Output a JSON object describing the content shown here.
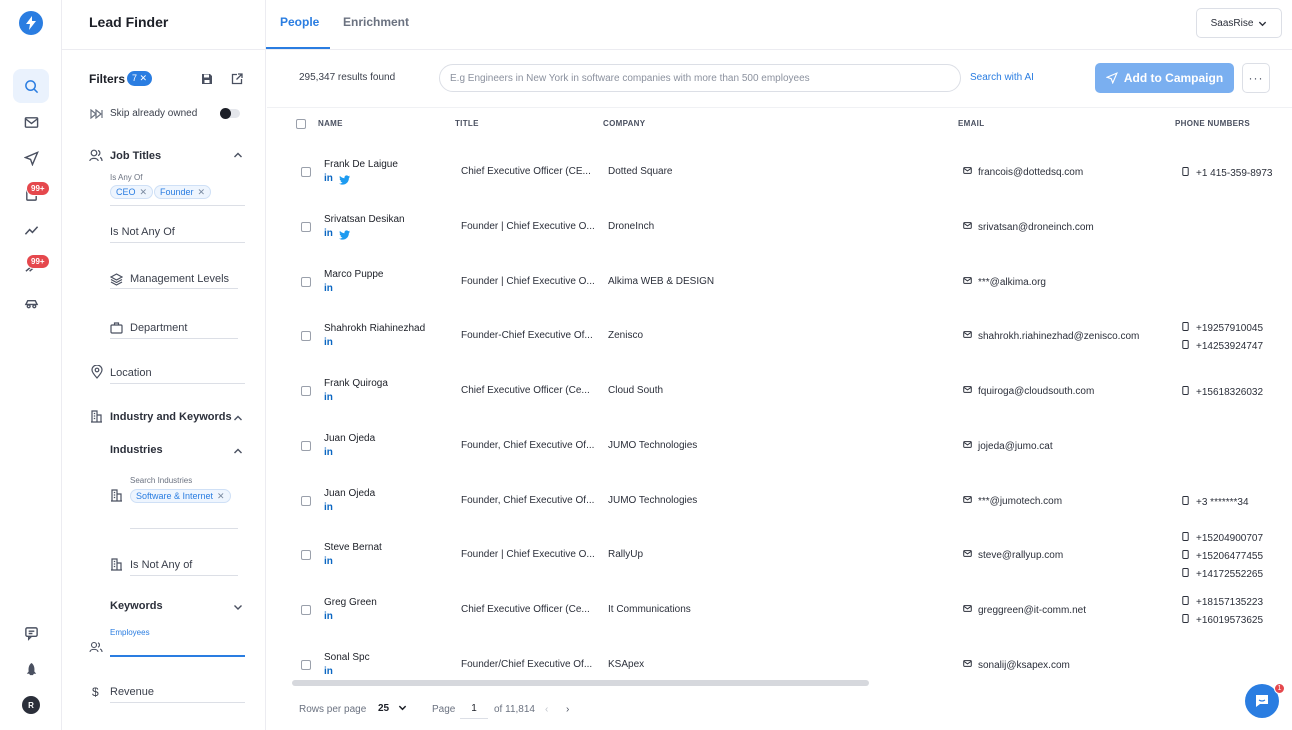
{
  "app": {
    "title": "Lead Finder",
    "workspace": "SaasRise",
    "avatar_initial": "R",
    "accent": "#2a7de1"
  },
  "tabs": [
    {
      "label": "People",
      "active": true
    },
    {
      "label": "Enrichment",
      "active": false
    }
  ],
  "rail": {
    "badge1": "99+",
    "badge2": "99+"
  },
  "filters": {
    "title": "Filters",
    "count": "7",
    "skip_owned": "Skip already owned",
    "job_titles": "Job Titles",
    "is_any_of": "Is Any Of",
    "tags": [
      "CEO",
      "Founder"
    ],
    "is_not_any_of": "Is Not Any Of",
    "management_levels": "Management Levels",
    "department": "Department",
    "location": "Location",
    "industry_keywords": "Industry and Keywords",
    "industries": "Industries",
    "search_industries": "Search Industries",
    "industry_tag": "Software & Internet",
    "industries_not_any": "Is Not Any of",
    "keywords": "Keywords",
    "employees": "Employees",
    "revenue": "Revenue"
  },
  "toolbar": {
    "results": "295,347 results found",
    "search_placeholder": "E.g Engineers in New York in software companies with more than 500 employees",
    "search_ai": "Search with AI",
    "add_campaign": "Add to Campaign",
    "more": "···"
  },
  "table": {
    "headers": {
      "name": "NAME",
      "title": "TITLE",
      "company": "COMPANY",
      "email": "EMAIL",
      "phones": "PHONE NUMBERS"
    },
    "rows": [
      {
        "name": "Frank De Laigue",
        "title": "Chief Executive Officer (CE...",
        "company": "Dotted Square",
        "email": "francois@dottedsq.com",
        "phones": [
          "+1 415-359-8973"
        ],
        "twitter": true
      },
      {
        "name": "Srivatsan Desikan",
        "title": "Founder | Chief Executive O...",
        "company": "DroneInch",
        "email": "srivatsan@droneinch.com",
        "phones": [],
        "twitter": true
      },
      {
        "name": "Marco Puppe",
        "title": "Founder | Chief Executive O...",
        "company": "Alkima WEB & DESIGN",
        "email": "***@alkima.org",
        "phones": [],
        "twitter": false
      },
      {
        "name": "Shahrokh Riahinezhad",
        "title": "Founder-Chief Executive Of...",
        "company": "Zenisco",
        "email": "shahrokh.riahinezhad@zenisco.com",
        "phones": [
          "+19257910045",
          "+14253924747"
        ],
        "twitter": false
      },
      {
        "name": "Frank Quiroga",
        "title": "Chief Executive Officer (Ce...",
        "company": "Cloud South",
        "email": "fquiroga@cloudsouth.com",
        "phones": [
          "+15618326032"
        ],
        "twitter": false
      },
      {
        "name": "Juan Ojeda",
        "title": "Founder, Chief Executive Of...",
        "company": "JUMO Technologies",
        "email": "jojeda@jumo.cat",
        "phones": [],
        "twitter": false
      },
      {
        "name": "Juan Ojeda",
        "title": "Founder, Chief Executive Of...",
        "company": "JUMO Technologies",
        "email": "***@jumotech.com",
        "phones": [
          "+3 *******34"
        ],
        "twitter": false
      },
      {
        "name": "Steve Bernat",
        "title": "Founder | Chief Executive O...",
        "company": "RallyUp",
        "email": "steve@rallyup.com",
        "phones": [
          "+15204900707",
          "+15206477455",
          "+14172552265"
        ],
        "twitter": false
      },
      {
        "name": "Greg Green",
        "title": "Chief Executive Officer (Ce...",
        "company": "It Communications",
        "email": "greggreen@it-comm.net",
        "phones": [
          "+18157135223",
          "+16019573625"
        ],
        "twitter": false
      },
      {
        "name": "Sonal Spc",
        "title": "Founder/Chief Executive Of...",
        "company": "KSApex",
        "email": "sonalij@ksapex.com",
        "phones": [],
        "twitter": false
      }
    ]
  },
  "pagination": {
    "rows_per_page": "Rows per page",
    "rows_value": "25",
    "page_label": "Page",
    "page": "1",
    "of_total": "of 11,814"
  },
  "chat": {
    "badge": "1"
  }
}
